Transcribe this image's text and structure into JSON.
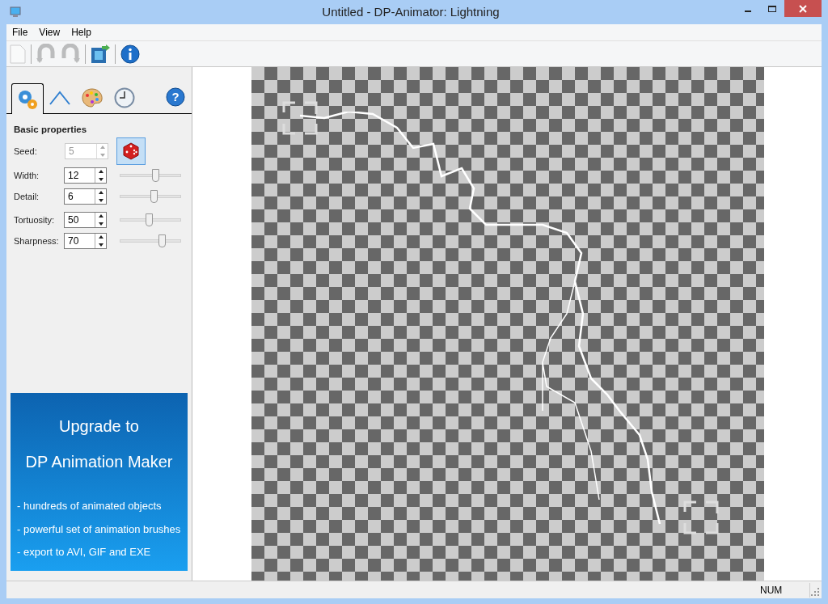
{
  "window": {
    "title": "Untitled - DP-Animator: Lightning"
  },
  "menu": [
    "File",
    "View",
    "Help"
  ],
  "toolbar": [
    {
      "kind": "new",
      "disabled": true
    },
    {
      "kind": "undo",
      "disabled": true
    },
    {
      "kind": "redo",
      "disabled": true
    },
    {
      "kind": "export",
      "disabled": false
    },
    {
      "kind": "info",
      "disabled": false
    }
  ],
  "tabs": [
    {
      "kind": "gears",
      "selected": true
    },
    {
      "kind": "line",
      "selected": false
    },
    {
      "kind": "palette",
      "selected": false
    },
    {
      "kind": "clock",
      "selected": false
    }
  ],
  "help_glyph": "?",
  "section_title": "Basic properties",
  "seed": {
    "label": "Seed:",
    "value": "5",
    "disabled": true
  },
  "properties": [
    {
      "label": "Width:",
      "value": "12",
      "level": 0.57
    },
    {
      "label": "Detail:",
      "value": "6",
      "level": 0.54
    },
    {
      "label": "Tortuosity:",
      "value": "50",
      "level": 0.47
    },
    {
      "label": "Sharpness:",
      "value": "70",
      "level": 0.67
    }
  ],
  "promo": {
    "title_lines": [
      "Upgrade to",
      "DP Animation Maker"
    ],
    "bullets": [
      "- hundreds of animated objects",
      "- powerful set of animation brushes",
      "- export to AVI, GIF and EXE"
    ]
  },
  "status_bar": {
    "num": "NUM"
  }
}
